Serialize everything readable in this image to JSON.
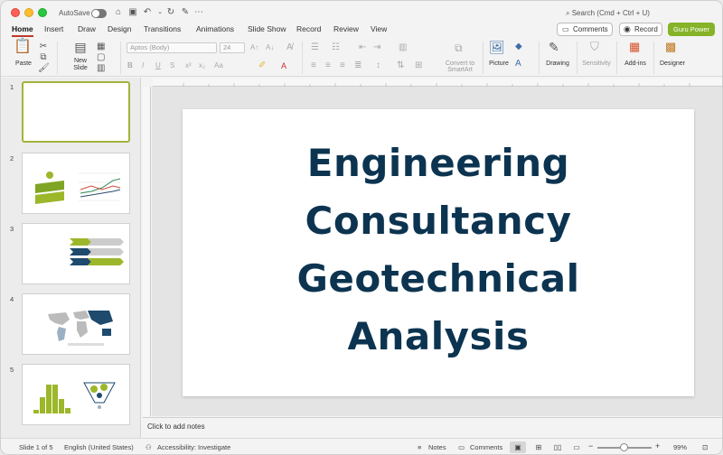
{
  "titlebar": {
    "autosave_label": "AutoSave",
    "search_placeholder": "Search (Cmd + Ctrl + U)"
  },
  "tabs": [
    {
      "label": "Home",
      "active": true
    },
    {
      "label": "Insert"
    },
    {
      "label": "Draw"
    },
    {
      "label": "Design"
    },
    {
      "label": "Transitions"
    },
    {
      "label": "Animations"
    },
    {
      "label": "Slide Show"
    },
    {
      "label": "Record"
    },
    {
      "label": "Review"
    },
    {
      "label": "View"
    }
  ],
  "header_buttons": {
    "comments": "Comments",
    "record": "Record",
    "guru": "Guru Power"
  },
  "ribbon": {
    "paste": "Paste",
    "new_slide_line1": "New",
    "new_slide_line2": "Slide",
    "font_name": "Aptos (Body)",
    "font_size": "24",
    "convert_line1": "Convert to",
    "convert_line2": "SmartArt",
    "picture": "Picture",
    "drawing": "Drawing",
    "sensitivity": "Sensitivity",
    "addins": "Add-ins",
    "designer": "Designer"
  },
  "slides": [
    {
      "number": "1"
    },
    {
      "number": "2"
    },
    {
      "number": "3"
    },
    {
      "number": "4"
    },
    {
      "number": "5"
    }
  ],
  "slide_title_lines": [
    "Engineering",
    "Consultancy",
    "Geotechnical",
    "Analysis"
  ],
  "notes_placeholder": "Click to add notes",
  "status": {
    "slide_info": "Slide 1 of 5",
    "language": "English (United States)",
    "accessibility": "Accessibility: Investigate",
    "notes": "Notes",
    "comments": "Comments",
    "zoom": "99%"
  },
  "colors": {
    "title_color": "#0c3450",
    "accent_green": "#86b328",
    "tab_underline": "#c0392b"
  }
}
